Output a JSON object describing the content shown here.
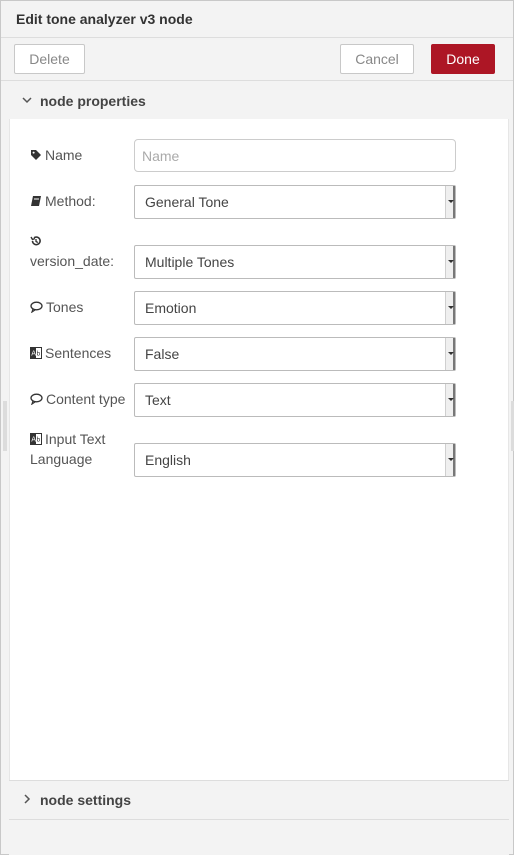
{
  "dialog": {
    "title": "Edit tone analyzer v3 node",
    "delete_label": "Delete",
    "cancel_label": "Cancel",
    "done_label": "Done",
    "accent_color": "#ad1625"
  },
  "sections": {
    "properties_label": "node properties",
    "settings_label": "node settings"
  },
  "form": {
    "name": {
      "label": "Name",
      "icon": "tag-icon",
      "value": "",
      "placeholder": "Name"
    },
    "method": {
      "label": "Method:",
      "icon": "book-icon",
      "value": "General Tone"
    },
    "version_date": {
      "label": "version_date:",
      "icon": "history-icon",
      "value": "Multiple Tones"
    },
    "tones": {
      "label": "Tones",
      "icon": "comment-icon",
      "value": "Emotion"
    },
    "sentences": {
      "label": "Sentences",
      "icon": "translate-icon",
      "value": "False"
    },
    "content_type": {
      "label": "Content type",
      "icon": "comment-icon",
      "value": "Text"
    },
    "input_language": {
      "label_line1": "Input Text",
      "label_line2": "Language",
      "icon": "translate-icon",
      "value": "English"
    }
  }
}
